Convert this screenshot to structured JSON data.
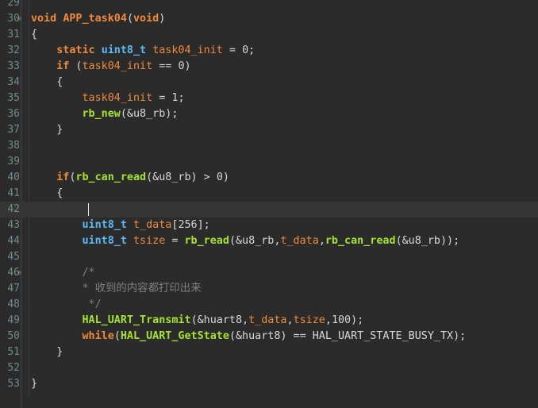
{
  "editor": {
    "colors": {
      "background": "#2b2b2b",
      "keyword": "#f08a3a",
      "type": "#5db9f5",
      "function_call": "#a6e22e",
      "identifier": "#d8d8d8",
      "comment": "#7f7f7f",
      "line_number": "#6f8c8c"
    },
    "current_line": 42,
    "lines": [
      {
        "n": "29",
        "fold": "",
        "segments": []
      },
      {
        "n": "30",
        "fold": "⊖",
        "segments": [
          {
            "t": "void",
            "c": "kw"
          },
          {
            "t": " ",
            "c": "id"
          },
          {
            "t": "APP_task04",
            "c": "fnd"
          },
          {
            "t": "(",
            "c": "id"
          },
          {
            "t": "void",
            "c": "kw"
          },
          {
            "t": ")",
            "c": "id"
          }
        ]
      },
      {
        "n": "31",
        "fold": "",
        "segments": [
          {
            "t": "{",
            "c": "id"
          }
        ]
      },
      {
        "n": "32",
        "fold": "",
        "segments": [
          {
            "t": "    ",
            "c": "id"
          },
          {
            "t": "static",
            "c": "kw"
          },
          {
            "t": " ",
            "c": "id"
          },
          {
            "t": "uint8_t",
            "c": "ty"
          },
          {
            "t": " ",
            "c": "id"
          },
          {
            "t": "task04_init",
            "c": "var"
          },
          {
            "t": " = ",
            "c": "id"
          },
          {
            "t": "0",
            "c": "num"
          },
          {
            "t": ";",
            "c": "id"
          }
        ]
      },
      {
        "n": "33",
        "fold": "",
        "segments": [
          {
            "t": "    ",
            "c": "id"
          },
          {
            "t": "if",
            "c": "kw"
          },
          {
            "t": " (",
            "c": "id"
          },
          {
            "t": "task04_init",
            "c": "var"
          },
          {
            "t": " == ",
            "c": "id"
          },
          {
            "t": "0",
            "c": "num"
          },
          {
            "t": ")",
            "c": "id"
          }
        ]
      },
      {
        "n": "34",
        "fold": "",
        "segments": [
          {
            "t": "    {",
            "c": "id"
          }
        ]
      },
      {
        "n": "35",
        "fold": "",
        "segments": [
          {
            "t": "        ",
            "c": "id"
          },
          {
            "t": "task04_init",
            "c": "var"
          },
          {
            "t": " = ",
            "c": "id"
          },
          {
            "t": "1",
            "c": "num"
          },
          {
            "t": ";",
            "c": "id"
          }
        ]
      },
      {
        "n": "36",
        "fold": "",
        "segments": [
          {
            "t": "        ",
            "c": "id"
          },
          {
            "t": "rb_new",
            "c": "fn"
          },
          {
            "t": "(&u8_rb);",
            "c": "id"
          }
        ]
      },
      {
        "n": "37",
        "fold": "",
        "segments": [
          {
            "t": "    }",
            "c": "id"
          }
        ]
      },
      {
        "n": "38",
        "fold": "",
        "segments": []
      },
      {
        "n": "39",
        "fold": "",
        "segments": []
      },
      {
        "n": "40",
        "fold": "",
        "segments": [
          {
            "t": "    ",
            "c": "id"
          },
          {
            "t": "if",
            "c": "kw"
          },
          {
            "t": "(",
            "c": "id"
          },
          {
            "t": "rb_can_read",
            "c": "fn"
          },
          {
            "t": "(&u8_rb) > ",
            "c": "id"
          },
          {
            "t": "0",
            "c": "num"
          },
          {
            "t": ")",
            "c": "id"
          }
        ]
      },
      {
        "n": "41",
        "fold": "",
        "segments": [
          {
            "t": "    {",
            "c": "id"
          }
        ]
      },
      {
        "n": "42",
        "fold": "",
        "segments": []
      },
      {
        "n": "43",
        "fold": "",
        "segments": [
          {
            "t": "        ",
            "c": "id"
          },
          {
            "t": "uint8_t",
            "c": "ty"
          },
          {
            "t": " ",
            "c": "id"
          },
          {
            "t": "t_data",
            "c": "var"
          },
          {
            "t": "[",
            "c": "id"
          },
          {
            "t": "256",
            "c": "num"
          },
          {
            "t": "];",
            "c": "id"
          }
        ]
      },
      {
        "n": "44",
        "fold": "",
        "segments": [
          {
            "t": "        ",
            "c": "id"
          },
          {
            "t": "uint8_t",
            "c": "ty"
          },
          {
            "t": " ",
            "c": "id"
          },
          {
            "t": "tsize",
            "c": "var"
          },
          {
            "t": " = ",
            "c": "id"
          },
          {
            "t": "rb_read",
            "c": "fn"
          },
          {
            "t": "(&u8_rb,",
            "c": "id"
          },
          {
            "t": "t_data",
            "c": "var"
          },
          {
            "t": ",",
            "c": "id"
          },
          {
            "t": "rb_can_read",
            "c": "fn"
          },
          {
            "t": "(&u8_rb));",
            "c": "id"
          }
        ]
      },
      {
        "n": "45",
        "fold": "",
        "segments": []
      },
      {
        "n": "46",
        "fold": "⊖",
        "segments": [
          {
            "t": "        /*",
            "c": "cmt"
          }
        ]
      },
      {
        "n": "47",
        "fold": "",
        "segments": [
          {
            "t": "        * 收到的内容都打印出来",
            "c": "cmt"
          }
        ]
      },
      {
        "n": "48",
        "fold": "",
        "segments": [
          {
            "t": "         */",
            "c": "cmt"
          }
        ]
      },
      {
        "n": "49",
        "fold": "",
        "segments": [
          {
            "t": "        ",
            "c": "id"
          },
          {
            "t": "HAL_UART_Transmit",
            "c": "fn"
          },
          {
            "t": "(&huart8,",
            "c": "id"
          },
          {
            "t": "t_data",
            "c": "var"
          },
          {
            "t": ",",
            "c": "id"
          },
          {
            "t": "tsize",
            "c": "var"
          },
          {
            "t": ",",
            "c": "id"
          },
          {
            "t": "100",
            "c": "num"
          },
          {
            "t": ");",
            "c": "id"
          }
        ]
      },
      {
        "n": "50",
        "fold": "",
        "segments": [
          {
            "t": "        ",
            "c": "id"
          },
          {
            "t": "while",
            "c": "kw"
          },
          {
            "t": "(",
            "c": "id"
          },
          {
            "t": "HAL_UART_GetState",
            "c": "fn"
          },
          {
            "t": "(&huart8) == HAL_UART_STATE_BUSY_TX);",
            "c": "id"
          }
        ]
      },
      {
        "n": "51",
        "fold": "",
        "segments": [
          {
            "t": "    }",
            "c": "id"
          }
        ]
      },
      {
        "n": "52",
        "fold": "",
        "segments": []
      },
      {
        "n": "53",
        "fold": "",
        "segments": [
          {
            "t": "}",
            "c": "id"
          }
        ]
      }
    ]
  }
}
